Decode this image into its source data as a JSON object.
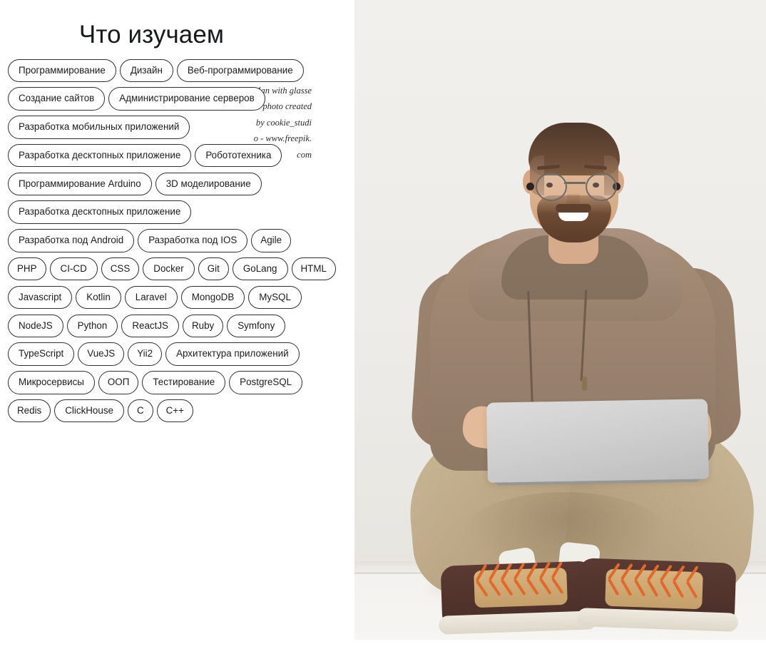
{
  "page": {
    "title": "Что изучаем",
    "background_color": "#ffffff",
    "text_color": "#18191b"
  },
  "tags": {
    "border_color": "#2f3033",
    "rows": [
      [
        "Программирование",
        "Дизайн",
        "Веб-программирование"
      ],
      [
        "Создание сайтов",
        "Администрирование серверов"
      ],
      [
        "Разработка мобильных приложений"
      ],
      [
        "Разработка десктопных приложение",
        "Робототехника"
      ],
      [
        "Программирование Arduino",
        "3D моделирование"
      ],
      [
        "Разработка десктопных приложение"
      ],
      [
        "Разработка под Android",
        "Разработка под IOS",
        "Agile"
      ],
      [
        "PHP",
        "CI-CD",
        "CSS",
        "Docker",
        "Git",
        "GoLang",
        "HTML"
      ],
      [
        "Javascript",
        "Kotlin",
        "Laravel",
        "MongoDB",
        "MySQL"
      ],
      [
        "NodeJS",
        "Python",
        "ReactJS",
        "Ruby",
        "Symfony"
      ],
      [
        "TypeScript",
        "VueJS",
        "Yii2",
        "Архитектура приложений"
      ],
      [
        "Микросервисы",
        "ООП",
        "Тестирование",
        "PostgreSQL"
      ],
      [
        "Redis",
        "ClickHouse",
        "C",
        "C++"
      ]
    ]
  },
  "image": {
    "alt_text": "Man with glasses photo created by cookie_studio - www.freepik.com",
    "description": "Smiling bearded man with round glasses wearing a tan hoodie and khaki trousers, sitting cross-legged on the floor with a silver laptop on his lap, wearing dark brown boots with orange laces and white socks",
    "background_color": "#edebe7",
    "hoodie_color": "#9b8370",
    "trousers_color": "#bda987",
    "laptop_color": "#cfcfcf",
    "laces_color": "#e2682b"
  }
}
